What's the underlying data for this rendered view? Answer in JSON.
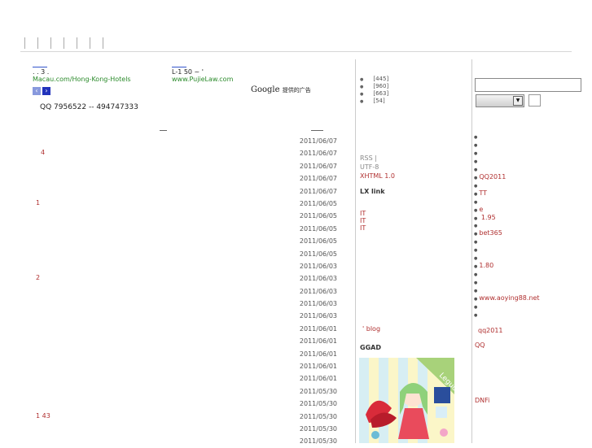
{
  "top_nav": [
    "",
    "",
    "",
    "",
    "",
    "",
    ""
  ],
  "ads": [
    {
      "title": ".   .    3 .",
      "url": "Macau.com/Hong-Kong-Hotels"
    },
    {
      "title": "L-1              50  ~  '",
      "url": "www.PujieLaw.com"
    }
  ],
  "google_ads_label": "Google",
  "google_ads_sub": "提供的广告",
  "qq_line": "QQ  7956522 -- 494747333",
  "posts": [
    {
      "title": "",
      "date": "2011/06/07"
    },
    {
      "title": "4",
      "date": "2011/06/07"
    },
    {
      "title": "",
      "date": "2011/06/07"
    },
    {
      "title": "",
      "date": "2011/06/07"
    },
    {
      "title": "",
      "date": "2011/06/07"
    },
    {
      "title": "1",
      "date": "2011/06/05"
    },
    {
      "title": "",
      "date": "2011/06/05"
    },
    {
      "title": "",
      "date": "2011/06/05"
    },
    {
      "title": "",
      "date": "2011/06/05"
    },
    {
      "title": "",
      "date": "2011/06/05"
    },
    {
      "title": "",
      "date": "2011/06/03"
    },
    {
      "title": "2",
      "date": "2011/06/03"
    },
    {
      "title": "",
      "date": "2011/06/03"
    },
    {
      "title": "",
      "date": "2011/06/03"
    },
    {
      "title": "",
      "date": "2011/06/03"
    },
    {
      "title": "",
      "date": "2011/06/01"
    },
    {
      "title": "",
      "date": "2011/06/01"
    },
    {
      "title": "",
      "date": "2011/06/01"
    },
    {
      "title": "",
      "date": "2011/06/01"
    },
    {
      "title": "",
      "date": "2011/06/01"
    },
    {
      "title": "",
      "date": "2011/05/30"
    },
    {
      "title": "",
      "date": "2011/05/30"
    },
    {
      "title": "1          43",
      "date": "2011/05/30"
    },
    {
      "title": "",
      "date": "2011/05/30"
    },
    {
      "title": "",
      "date": "2011/05/30"
    }
  ],
  "categories": [
    "[445]",
    "[960]",
    "[663]",
    "[54]"
  ],
  "rss": {
    "line1": "RSS   |",
    "line2": "  UTF-8",
    "line3": "XHTML 1.0"
  },
  "lx_link_title": "LX link",
  "it_links": [
    "  IT",
    "IT",
    "  IT"
  ],
  "blog_link": "' blog",
  "ggad_title": "GGAD",
  "ggad_badge": "Leguo",
  "right_links": [
    "",
    "",
    "",
    "",
    "",
    "QQ2011",
    "",
    "TT",
    "",
    "e",
    "   1.95",
    "",
    "bet365",
    "",
    "",
    "",
    "1.80",
    "",
    "",
    "",
    "www.aoying88.net",
    "",
    ""
  ],
  "right_qq2011": "qq2011",
  "right_qq": "QQ",
  "right_dnf": "DNFi",
  "colors": {
    "link_red": "#b03030",
    "url_green": "#2a8a2a",
    "border": "#cccccc"
  }
}
